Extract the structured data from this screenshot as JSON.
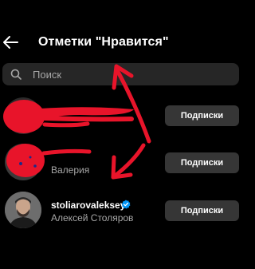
{
  "header": {
    "title": "Отметки \"Нравится\"",
    "back_icon": "arrow-left-icon"
  },
  "search": {
    "placeholder": "Поиск",
    "value": "",
    "icon": "search-icon"
  },
  "users": [
    {
      "username": "",
      "full_name": "",
      "follow_label": "Подписки",
      "verified": false
    },
    {
      "username": "",
      "full_name": "Валерия",
      "follow_label": "Подписки",
      "verified": false
    },
    {
      "username": "stoliarovaleksey",
      "full_name": "Алексей Столяров",
      "follow_label": "Подписки",
      "verified": true
    }
  ],
  "colors": {
    "background": "#000000",
    "search_bg": "#262626",
    "button_bg": "#363636",
    "secondary_text": "#a8a8a8",
    "verified": "#0095f6",
    "annotation_red": "#e8142a"
  }
}
